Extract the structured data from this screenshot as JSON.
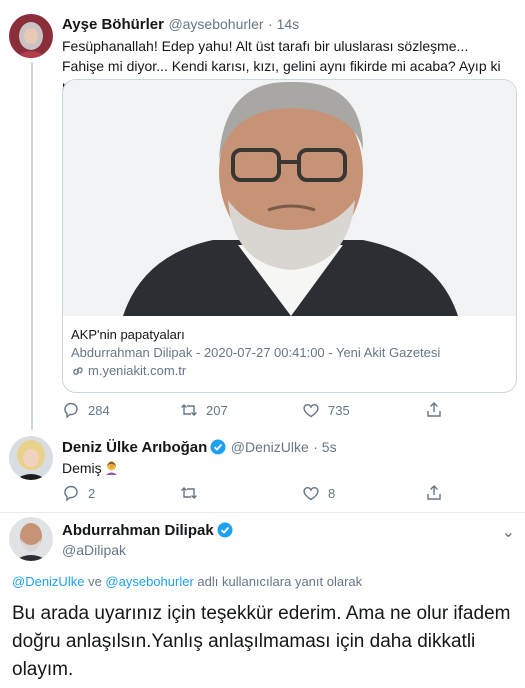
{
  "tweet1": {
    "name": "Ayşe Böhürler",
    "handle": "@aysebohurler",
    "time": "· 14s",
    "text": "Fesüphanallah! Edep yahu! Alt üst tarafı bir uluslarası sözleşme... Fahişe mi diyor... Kendi karısı, kızı, gelini aynı fikirde mi acaba? Ayıp ki ne ayıp!",
    "card": {
      "title": "AKP'nin papatyaları",
      "description": "Abdurrahman Dilipak - 2020-07-27 00:41:00 - Yeni Akit Gazetesi",
      "domain": "m.yeniakit.com.tr"
    },
    "actions": {
      "replies": "284",
      "retweets": "207",
      "likes": "735"
    }
  },
  "tweet2": {
    "name": "Deniz Ülke Arıboğan",
    "handle": "@DenizUlke",
    "time": "· 5s",
    "text": "Demiş",
    "emoji": "woman-facepalming-emoji",
    "actions": {
      "replies": "2",
      "retweets": "",
      "likes": "8"
    }
  },
  "tweet3": {
    "name": "Abdurrahman Dilipak",
    "handle": "@aDilipak",
    "reply_mention1": "@DenizUlke",
    "reply_and": " ve ",
    "reply_mention2": "@aysebohurler",
    "reply_suffix": " adlı kullanıcılara yanıt olarak",
    "text": "Bu arada uyarınız için teşekkür ederim. Ama ne olur ifadem doğru anlaşılsın.Yanlış anlaşılmaması için daha dikkatli olayım."
  },
  "icons": [
    "reply-icon",
    "retweet-icon",
    "like-icon",
    "share-icon",
    "link-icon",
    "verified-icon",
    "more-icon"
  ],
  "colors": {
    "accent": "#1da1f2",
    "secondary_text": "#657786",
    "border": "#ccd6dd"
  }
}
